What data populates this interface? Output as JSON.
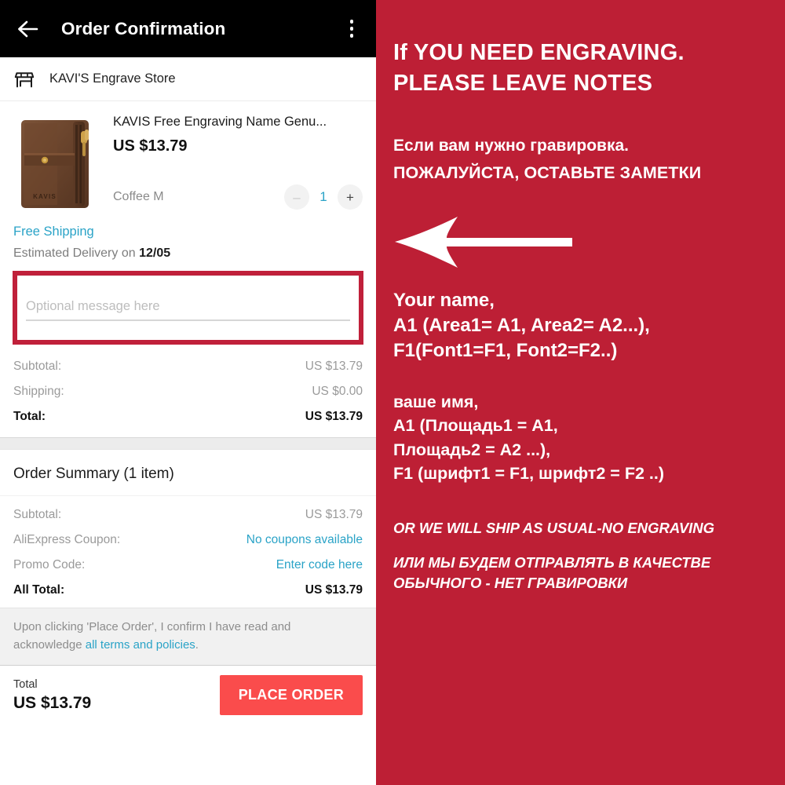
{
  "app": {
    "title": "Order Confirmation",
    "back_icon": "arrow-left-icon",
    "menu_icon": "kebab-menu-icon"
  },
  "store": {
    "icon": "storefront-icon",
    "name": "KAVI'S Engrave Store"
  },
  "product": {
    "image_alt": "brown-leather-wallet",
    "title": "KAVIS Free Engraving Name Genu...",
    "price": "US $13.79",
    "variant": "Coffee M",
    "quantity": "1",
    "decrease_label": "–",
    "increase_label": "+"
  },
  "shipping": {
    "method": "Free Shipping",
    "estimate_label": "Estimated Delivery on",
    "estimate_date": "12/05"
  },
  "message": {
    "placeholder": "Optional message here",
    "value": "",
    "highlight_color": "#c0203a"
  },
  "totals": {
    "rows": [
      {
        "label": "Subtotal:",
        "value": "US $13.79",
        "strong": false
      },
      {
        "label": "Shipping:",
        "value": "US $0.00",
        "strong": false
      },
      {
        "label": "Total:",
        "value": "US $13.79",
        "strong": true
      }
    ]
  },
  "summary": {
    "title": "Order Summary (1 item)",
    "rows": [
      {
        "label": "Subtotal:",
        "value": "US $13.79",
        "link": false,
        "strong": false
      },
      {
        "label": "AliExpress Coupon:",
        "value": "No coupons available",
        "link": true,
        "strong": false
      },
      {
        "label": "Promo Code:",
        "value": "Enter code here",
        "link": true,
        "strong": false
      },
      {
        "label": "All Total:",
        "value": "US $13.79",
        "link": false,
        "strong": true
      }
    ]
  },
  "terms": {
    "text_before": "Upon clicking 'Place Order', I confirm I have read and acknowledge ",
    "link_text": "all terms and policies",
    "text_after": "."
  },
  "footer": {
    "total_label": "Total",
    "total_value": "US $13.79",
    "place_order_label": "PLACE ORDER",
    "button_color": "#fa4c4c"
  },
  "panel": {
    "background_color": "#bd1f35",
    "heading_en_line1": "If YOU NEED ENGRAVING.",
    "heading_en_line2": "PLEASE LEAVE NOTES",
    "heading_ru_line1": "Если вам нужно гравировка.",
    "heading_ru_line2": "ПОЖАЛУЙСТА, ОСТАВЬТЕ ЗАМЕТКИ",
    "arrow_icon": "arrow-left-pointer-icon",
    "name_en_line1": "Your name,",
    "name_en_line2": "A1  (Area1= A1, Area2= A2...),",
    "name_en_line3": "F1(Font1=F1, Font2=F2..)",
    "name_ru_line1": "ваше имя,",
    "name_ru_line2": "A1 (Площадь1 = A1,",
    "name_ru_line3": "Площадь2 = A2 ...),",
    "name_ru_line4": "F1 (шрифт1 = F1, шрифт2 = F2 ..)",
    "footer_en": "OR WE WILL SHIP AS USUAL-NO ENGRAVING",
    "footer_ru_line1": "ИЛИ МЫ БУДЕМ ОТПРАВЛЯТЬ В КАЧЕСТВЕ",
    "footer_ru_line2": "ОБЫЧНОГО - НЕТ ГРАВИРОВКИ"
  }
}
